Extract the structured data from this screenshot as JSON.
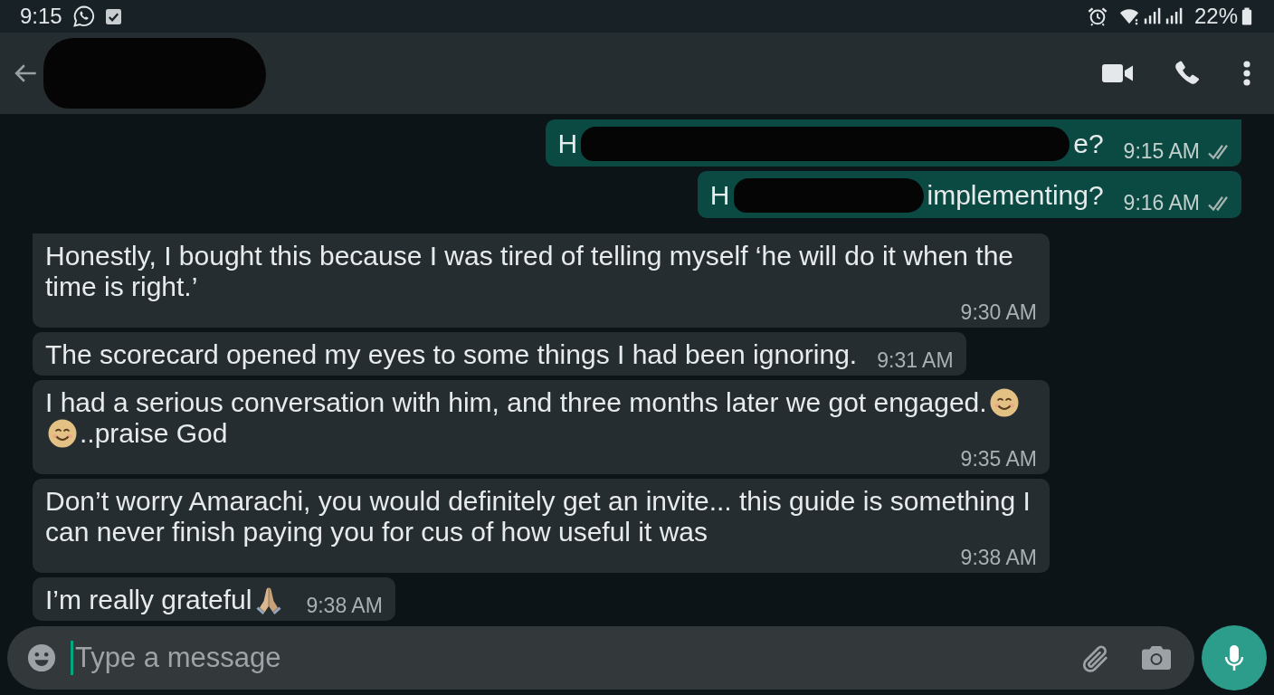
{
  "status_bar": {
    "time": "9:15",
    "battery": "22%"
  },
  "header": {
    "contact_redacted": true
  },
  "messages": [
    {
      "kind": "outgoing",
      "parts": [
        {
          "kind": "text",
          "text": "H"
        },
        {
          "kind": "redacted"
        },
        {
          "kind": "text",
          "text": "e?"
        }
      ],
      "time": "9:15 AM",
      "read": false
    },
    {
      "kind": "outgoing",
      "parts": [
        {
          "kind": "text",
          "text": "H"
        },
        {
          "kind": "redacted"
        },
        {
          "kind": "text",
          "text": "implementing?"
        }
      ],
      "time": "9:16 AM",
      "read": false
    },
    {
      "kind": "incoming",
      "parts": [
        {
          "kind": "text",
          "text": "Honestly, I bought this because I was tired of telling myself ‘he will do it when the time is right.’"
        }
      ],
      "time": "9:30 AM"
    },
    {
      "kind": "incoming",
      "parts": [
        {
          "kind": "text",
          "text": "The scorecard opened my eyes to some things I had been ignoring."
        }
      ],
      "time": "9:31 AM"
    },
    {
      "kind": "incoming",
      "parts": [
        {
          "kind": "text",
          "text": "I had a serious conversation with him, and three months later we got engaged."
        },
        {
          "kind": "smiley"
        },
        {
          "kind": "smiley"
        },
        {
          "kind": "text",
          "text": "..praise God"
        }
      ],
      "time": "9:35 AM"
    },
    {
      "kind": "incoming",
      "parts": [
        {
          "kind": "text",
          "text": "Don’t worry Amarachi, you would definitely get an invite... this guide is something I can never finish paying you for cus of how useful it was"
        }
      ],
      "time": "9:38 AM"
    },
    {
      "kind": "incoming",
      "parts": [
        {
          "kind": "text",
          "text": "I’m really grateful"
        },
        {
          "kind": "prayer"
        }
      ],
      "time": "9:38 AM"
    }
  ],
  "composer": {
    "placeholder": "Type a message",
    "focused": true
  }
}
